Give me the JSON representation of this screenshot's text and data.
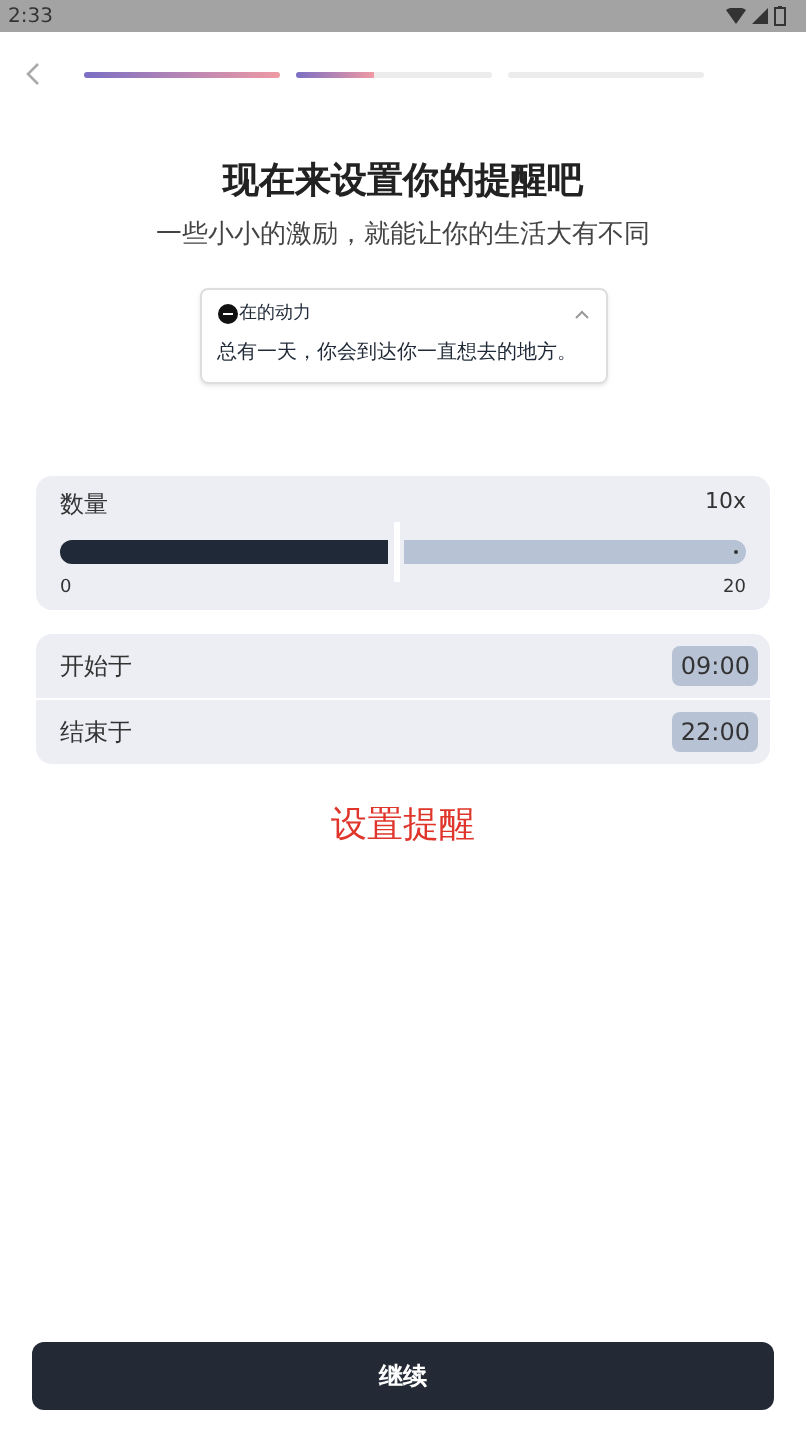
{
  "status_bar": {
    "time": "2:33"
  },
  "progress": [
    {
      "kind": "filled",
      "level": 1
    },
    {
      "kind": "filled",
      "level": 0.4
    },
    {
      "kind": "empty"
    }
  ],
  "title": "现在来设置你的提醒吧",
  "subtitle": "一些小小的激励，就能让你的生活大有不同",
  "motivation_card": {
    "label": "在的动力",
    "text": "总有一天，你会到达你一直想去的地方。",
    "expanded": true
  },
  "quantity": {
    "label": "数量",
    "reading": "10x",
    "level": 0.5,
    "min": "0",
    "max": "20"
  },
  "times": [
    {
      "label": "开始于",
      "value": "09:00"
    },
    {
      "label": "结束于",
      "value": "22:00"
    }
  ],
  "set_reminder": "设置提醒",
  "continue_button": "继续"
}
